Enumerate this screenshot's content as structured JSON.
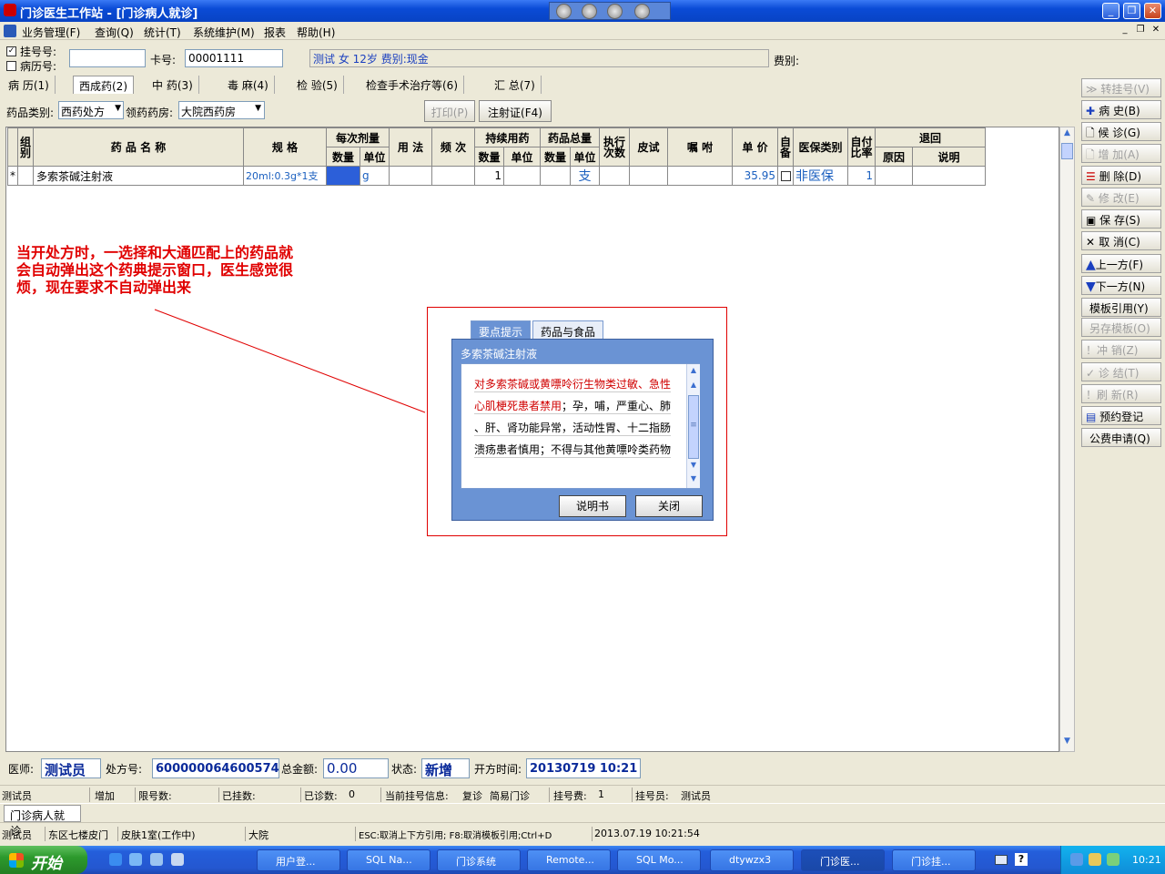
{
  "window": {
    "title": "门诊医生工作站 - [门诊病人就诊]"
  },
  "menu": [
    "业务管理(F)",
    "查询(Q)",
    "统计(T)",
    "系统维护(M)",
    "报表",
    "帮助(H)"
  ],
  "patient": {
    "reg_label": "挂号号:",
    "record_label": "病历号:",
    "reg_value": "",
    "card_label": "卡号:",
    "card_value": "00001111",
    "info": "测试 女 12岁 费别:现金",
    "fee_label": "费别:"
  },
  "tabs": [
    "病 历(1)",
    "西成药(2)",
    "中 药(3)",
    "毒 麻(4)",
    "检 验(5)",
    "检查手术治疗等(6)",
    "汇 总(7)"
  ],
  "drug_filter": {
    "type_label": "药品类别:",
    "type_value": "西药处方",
    "pharmacy_label": "领药药房:",
    "pharmacy_value": "大院西药房",
    "print": "打印(P)",
    "injection": "注射证(F4)"
  },
  "grid": {
    "headers": {
      "group": "组别",
      "name": "药 品 名 称",
      "spec": "规 格",
      "dose": "每次剂量",
      "qty": "数量",
      "unit": "单位",
      "usage": "用 法",
      "freq": "频 次",
      "cont": "持续用药",
      "total": "药品总量",
      "exec": "执行次数",
      "skin": "皮试",
      "advice": "嘱 咐",
      "price": "单 价",
      "self": "自备",
      "ins": "医保类别",
      "ratio": "自付比率",
      "ret": "退回",
      "reason": "原因",
      "note": "说明"
    },
    "row": {
      "marker": "*",
      "name": "多索茶碱注射液",
      "spec": "20ml:0.3g*1支",
      "dose_unit": "g",
      "cont_qty": "1",
      "total_unit": "支",
      "price": "35.95",
      "ins": "非医保",
      "ratio": "1"
    }
  },
  "right_buttons": [
    {
      "label": "转挂号(V)",
      "enabled": false
    },
    {
      "label": "病 史(B)",
      "enabled": true
    },
    {
      "label": "候 诊(G)",
      "enabled": true
    },
    {
      "label": "增 加(A)",
      "enabled": false
    },
    {
      "label": "删 除(D)",
      "enabled": true
    },
    {
      "label": "修 改(E)",
      "enabled": false
    },
    {
      "label": "保 存(S)",
      "enabled": true
    },
    {
      "label": "取 消(C)",
      "enabled": true
    },
    {
      "label": "上一方(F)",
      "enabled": true
    },
    {
      "label": "下一方(N)",
      "enabled": true
    },
    {
      "label": "模板引用(Y)",
      "enabled": true
    },
    {
      "label": "另存模板(O)",
      "enabled": false
    },
    {
      "label": "冲 销(Z)",
      "enabled": false
    },
    {
      "label": "诊 结(T)",
      "enabled": false
    },
    {
      "label": "刷 新(R)",
      "enabled": false
    },
    {
      "label": "预约登记",
      "enabled": true
    },
    {
      "label": "公费申请(Q)",
      "enabled": true
    }
  ],
  "annotation": "当开处方时，一选择和大通匹配上的药品就会自动弹出这个药典提示窗口，医生感觉很烦，现在要求不自动弹出来",
  "popup": {
    "tab1": "要点提示",
    "tab2": "药品与食品",
    "drug": "多索茶碱注射液",
    "line1": "对多索茶碱或黄嘌呤衍生物类过敏、急性",
    "line2a": "心肌梗死患者禁用",
    "line2b": "；孕，哺，严重心、肺",
    "line3": "、肝、肾功能异常，活动性胃、十二指肠",
    "line4": "溃疡患者慎用；不得与其他黄嘌呤类药物",
    "btn_manual": "说明书",
    "btn_close": "关闭"
  },
  "footer": {
    "doctor_label": "医师:",
    "doctor": "测试员",
    "rx_label": "处方号:",
    "rx": "600000064600574",
    "amount_label": "总金额:",
    "amount": "0.00",
    "state_label": "状态:",
    "state": "新增",
    "time_label": "开方时间:",
    "time": "20130719 10:21"
  },
  "status1": {
    "user": "测试员",
    "action": "增加",
    "limit": "限号数:",
    "registered": "已挂数:",
    "seen": "已诊数:",
    "seen_val": "0",
    "current": "当前挂号信息:",
    "visit": "复诊",
    "clinic": "简易门诊",
    "fee": "挂号费:",
    "fee_val": "1",
    "clerk": "挂号员:",
    "clerk_val": "测试员"
  },
  "status2": {
    "tab": "门诊病人就诊"
  },
  "status3": {
    "user": "测试员",
    "dept": "东区七楼皮门",
    "room": "皮肤1室(工作中)",
    "campus": "大院",
    "hint": "ESC:取消上下方引用; F8:取消模板引用;Ctrl+D",
    "datetime": "2013.07.19 10:21:54"
  },
  "taskbar": {
    "start": "开始",
    "tasks": [
      "用户登...",
      "SQL Na...",
      "门诊系统",
      "Remote...",
      "SQL Mo...",
      "dtywzx3",
      "门诊医...",
      "门诊挂..."
    ],
    "clock": "10:21"
  },
  "colors": {
    "annotation": "#e00000",
    "link_blue": "#0a2a9a",
    "titlebar": "#0a4bd6"
  }
}
